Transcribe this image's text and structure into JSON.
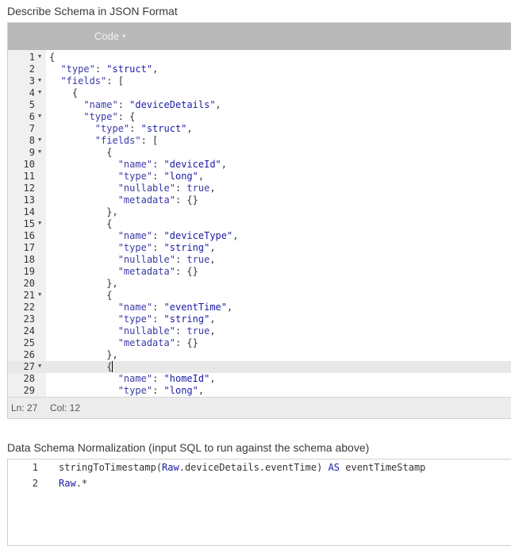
{
  "schema_section": {
    "title": "Describe Schema in JSON Format",
    "toolbar": {
      "code_label": "Code",
      "caret": "▾"
    },
    "lines": [
      {
        "n": "1",
        "fold": true,
        "html": "{"
      },
      {
        "n": "2",
        "fold": false,
        "html": "  <span class='k'>\"type\"</span>: <span class='s'>\"struct\"</span>,"
      },
      {
        "n": "3",
        "fold": true,
        "html": "  <span class='k'>\"fields\"</span>: ["
      },
      {
        "n": "4",
        "fold": true,
        "html": "    {"
      },
      {
        "n": "5",
        "fold": false,
        "html": "      <span class='k'>\"name\"</span>: <span class='s'>\"deviceDetails\"</span>,"
      },
      {
        "n": "6",
        "fold": true,
        "html": "      <span class='k'>\"type\"</span>: {"
      },
      {
        "n": "7",
        "fold": false,
        "html": "        <span class='k'>\"type\"</span>: <span class='s'>\"struct\"</span>,"
      },
      {
        "n": "8",
        "fold": true,
        "html": "        <span class='k'>\"fields\"</span>: ["
      },
      {
        "n": "9",
        "fold": true,
        "html": "          {"
      },
      {
        "n": "10",
        "fold": false,
        "html": "            <span class='k'>\"name\"</span>: <span class='s'>\"deviceId\"</span>,"
      },
      {
        "n": "11",
        "fold": false,
        "html": "            <span class='k'>\"type\"</span>: <span class='s'>\"long\"</span>,"
      },
      {
        "n": "12",
        "fold": false,
        "html": "            <span class='k'>\"nullable\"</span>: <span class='b'>true</span>,"
      },
      {
        "n": "13",
        "fold": false,
        "html": "            <span class='k'>\"metadata\"</span>: {}"
      },
      {
        "n": "14",
        "fold": false,
        "html": "          },"
      },
      {
        "n": "15",
        "fold": true,
        "html": "          {"
      },
      {
        "n": "16",
        "fold": false,
        "html": "            <span class='k'>\"name\"</span>: <span class='s'>\"deviceType\"</span>,"
      },
      {
        "n": "17",
        "fold": false,
        "html": "            <span class='k'>\"type\"</span>: <span class='s'>\"string\"</span>,"
      },
      {
        "n": "18",
        "fold": false,
        "html": "            <span class='k'>\"nullable\"</span>: <span class='b'>true</span>,"
      },
      {
        "n": "19",
        "fold": false,
        "html": "            <span class='k'>\"metadata\"</span>: {}"
      },
      {
        "n": "20",
        "fold": false,
        "html": "          },"
      },
      {
        "n": "21",
        "fold": true,
        "html": "          {"
      },
      {
        "n": "22",
        "fold": false,
        "html": "            <span class='k'>\"name\"</span>: <span class='s'>\"eventTime\"</span>,"
      },
      {
        "n": "23",
        "fold": false,
        "html": "            <span class='k'>\"type\"</span>: <span class='s'>\"string\"</span>,"
      },
      {
        "n": "24",
        "fold": false,
        "html": "            <span class='k'>\"nullable\"</span>: <span class='b'>true</span>,"
      },
      {
        "n": "25",
        "fold": false,
        "html": "            <span class='k'>\"metadata\"</span>: {}"
      },
      {
        "n": "26",
        "fold": false,
        "html": "          },"
      },
      {
        "n": "27",
        "fold": true,
        "active": true,
        "html": "          {<span class='cursor'></span>"
      },
      {
        "n": "28",
        "fold": false,
        "html": "            <span class='k'>\"name\"</span>: <span class='s'>\"homeId\"</span>,"
      },
      {
        "n": "29",
        "fold": false,
        "html": "            <span class='k'>\"type\"</span>: <span class='s'>\"long\"</span>,"
      }
    ],
    "status": {
      "ln": "Ln: 27",
      "col": "Col: 12"
    }
  },
  "sql_section": {
    "title": "Data Schema Normalization (input SQL to run against the schema above)",
    "lines": [
      {
        "n": "1",
        "html": "stringToTimestamp(<span class='kw'>Raw</span>.deviceDetails.eventTime) <span class='kw'>AS</span> eventTimeStamp"
      },
      {
        "n": "2",
        "html": "<span class='kw'>Raw</span>.*"
      }
    ]
  }
}
